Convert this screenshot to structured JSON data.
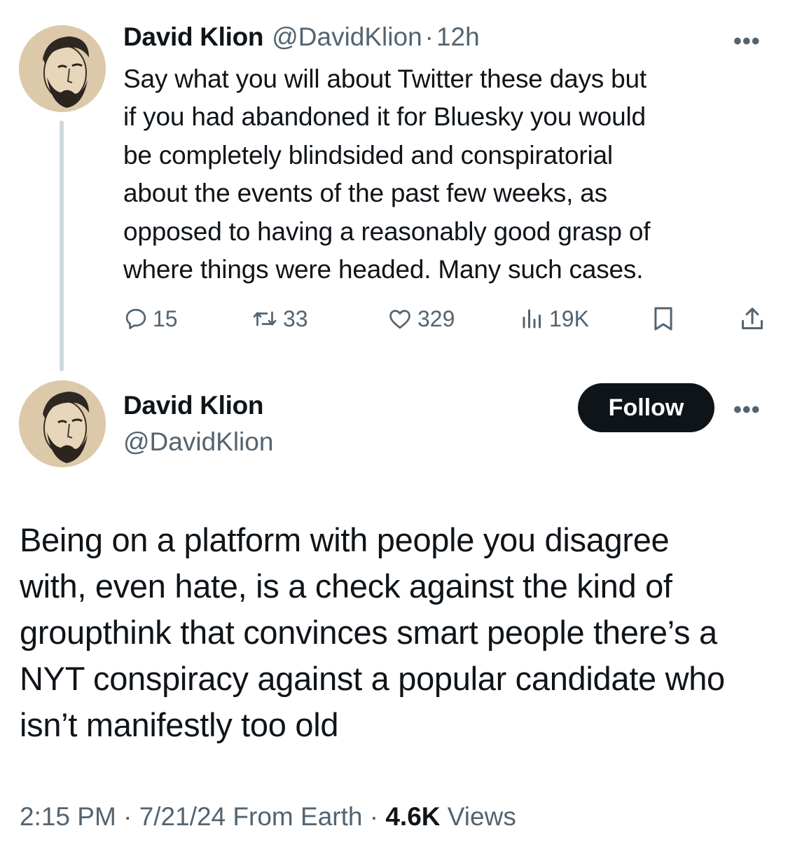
{
  "reply_tweet": {
    "author_name": "David Klion",
    "author_handle": "@DavidKlion",
    "separator": "·",
    "time_ago": "12h",
    "more_label": "•••",
    "text_lines": [
      "Say what you will about Twitter these days but",
      "if you had abandoned it for Bluesky you would",
      "be completely blindsided and conspiratorial",
      "about the events of the past few weeks, as",
      "opposed to having a reasonably good grasp of",
      "where things were headed. Many such cases."
    ],
    "actions": {
      "replies": "15",
      "retweets": "33",
      "likes": "329",
      "views": "19K"
    },
    "icons": [
      "reply-icon",
      "retweet-icon",
      "like-icon",
      "views-icon",
      "bookmark-icon",
      "share-icon"
    ]
  },
  "main_tweet": {
    "author_name": "David Klion",
    "author_handle": "@DavidKlion",
    "follow_label": "Follow",
    "more_label": "•••",
    "text_lines": [
      "Being on a platform with people you disagree",
      "with, even hate, is a check against the kind of",
      "groupthink that convinces smart people there’s a",
      "NYT conspiracy against a popular candidate who",
      "isn’t manifestly too old"
    ],
    "meta": {
      "time": "2:15 PM",
      "sep1": " · ",
      "date": "7/21/24",
      "location": " From Earth",
      "sep2": " · ",
      "views_count": "4.6K",
      "views_label": " Views"
    }
  },
  "colors": {
    "text": "#0f1419",
    "secondary": "#536471",
    "thread_line": "#cfd9de",
    "follow_bg": "#0f1419"
  }
}
